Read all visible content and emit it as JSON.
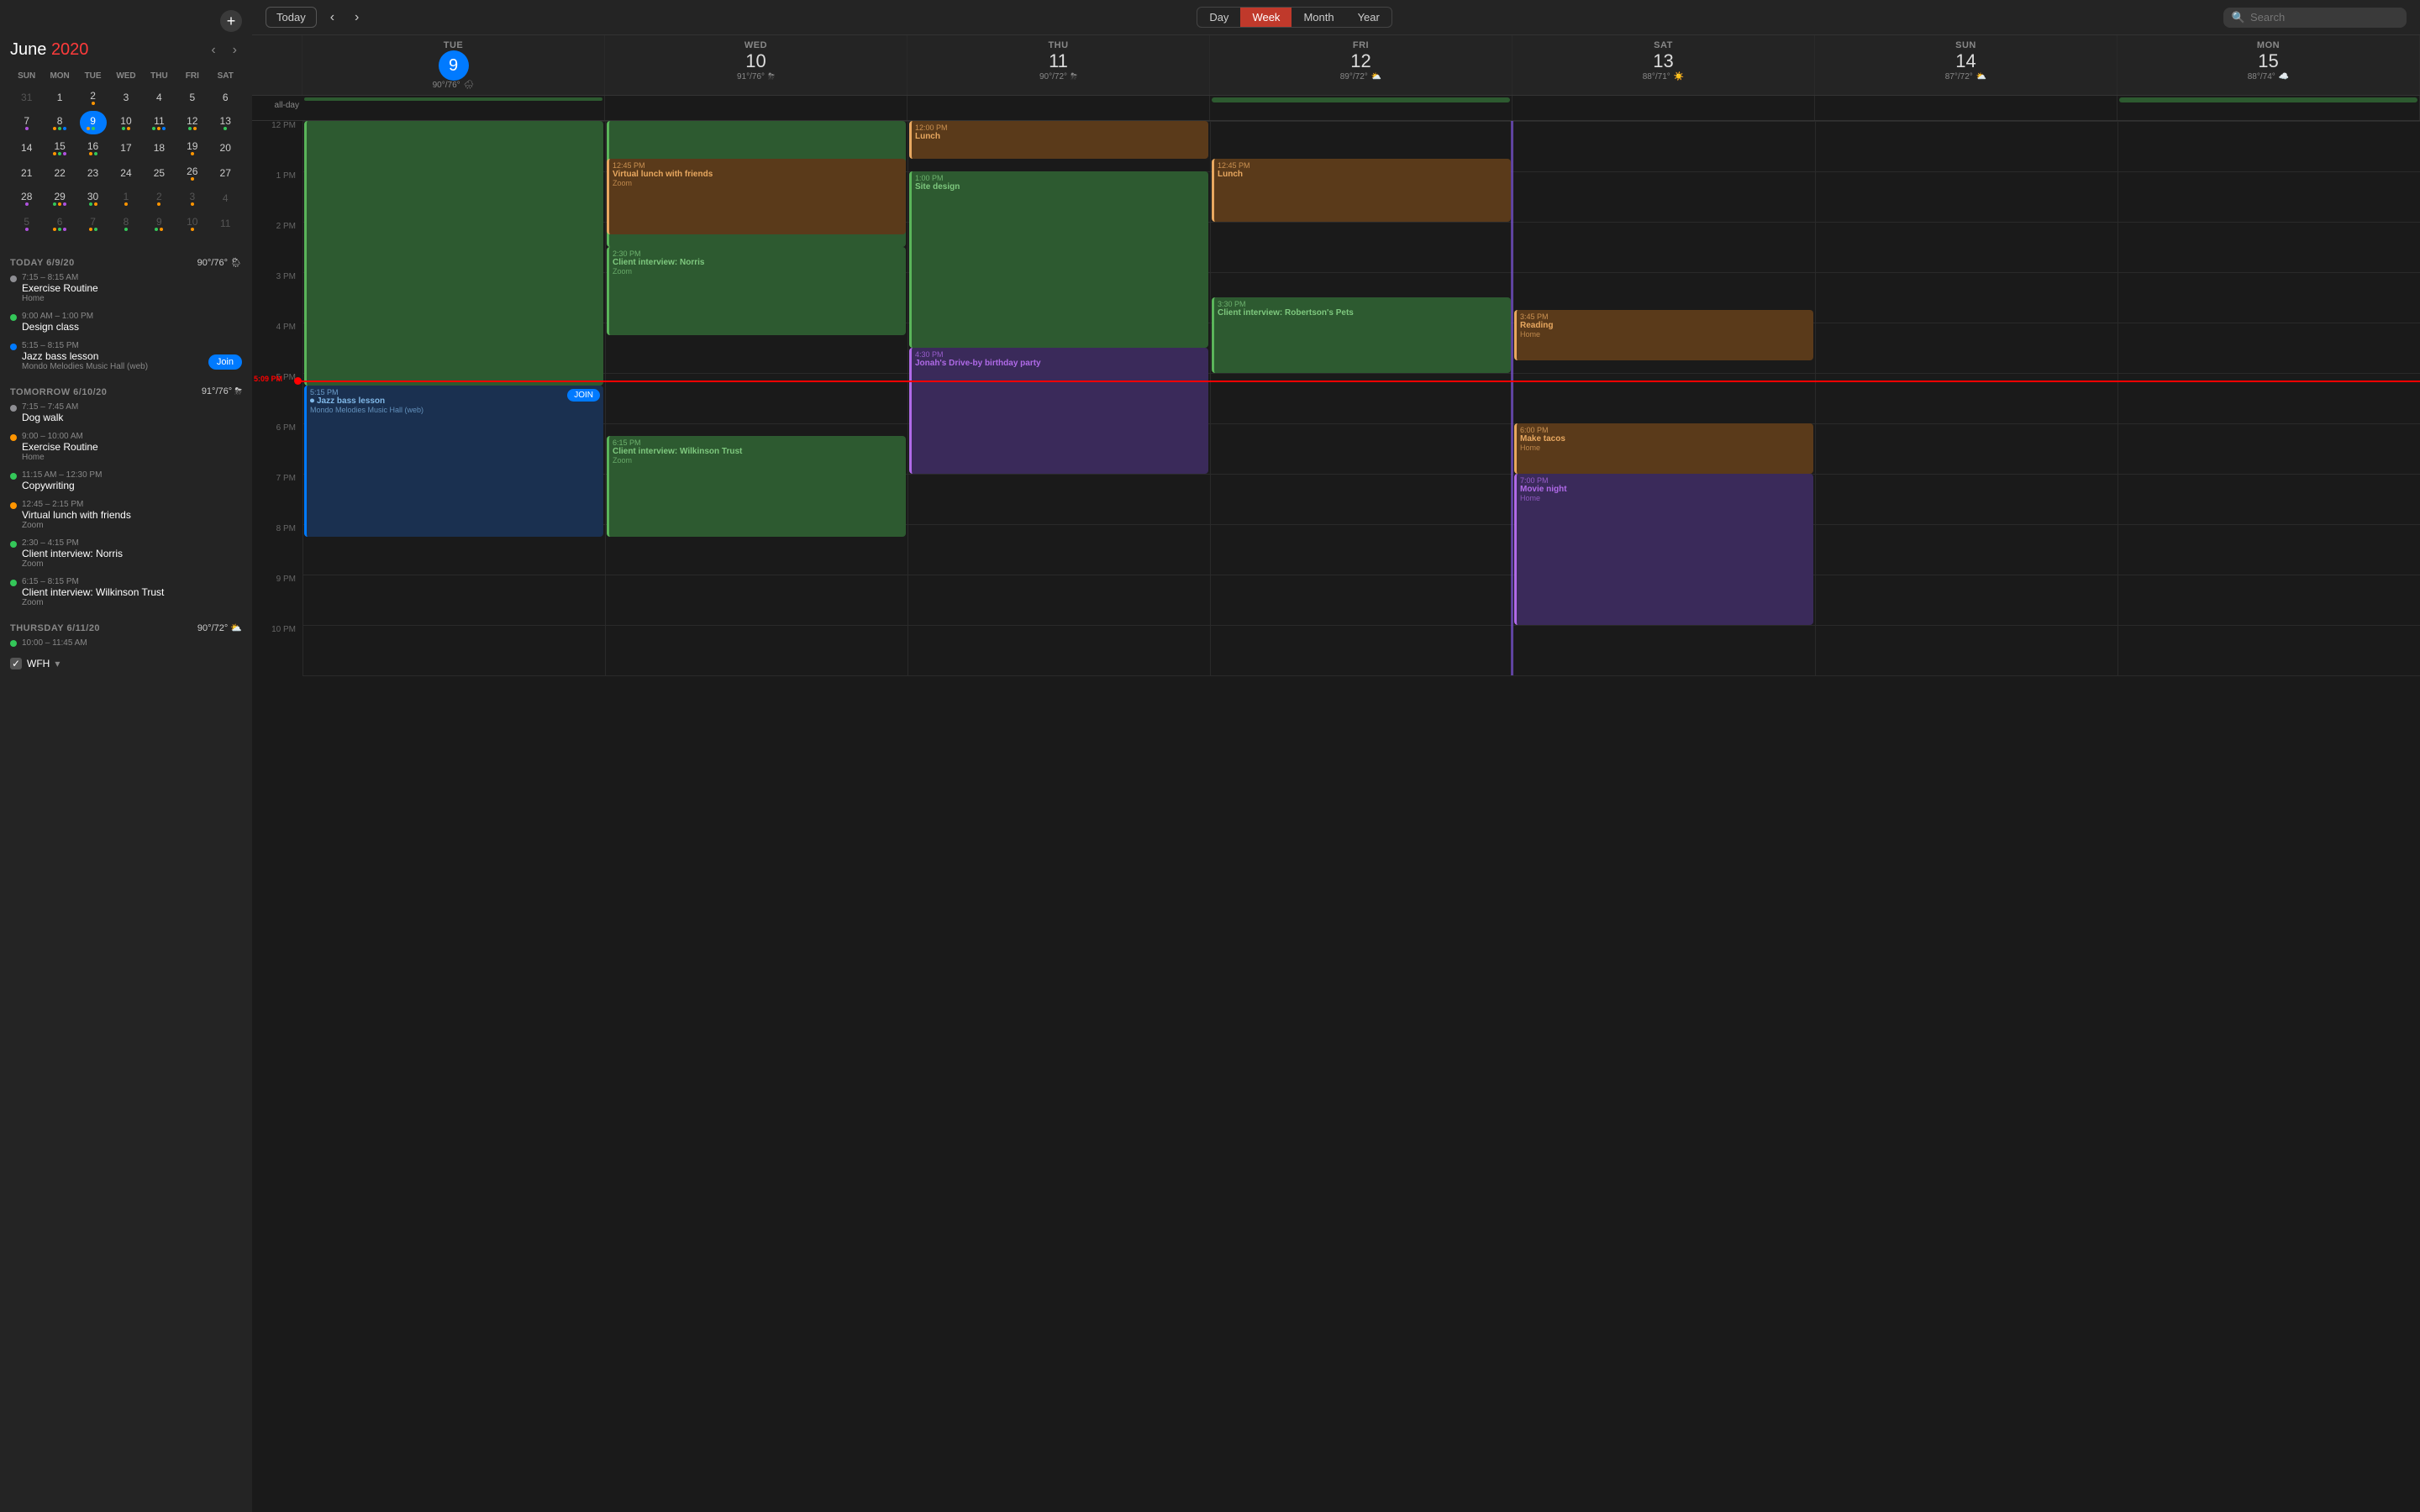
{
  "sidebar": {
    "add_btn": "+",
    "month": "June",
    "year": "2020",
    "nav_prev": "‹",
    "nav_next": "›",
    "mini_cal": {
      "headers": [
        "SUN",
        "MON",
        "TUE",
        "WED",
        "THU",
        "FRI",
        "SAT"
      ],
      "rows": [
        [
          {
            "num": "31",
            "other": true,
            "dots": []
          },
          {
            "num": "1",
            "dots": []
          },
          {
            "num": "2",
            "dots": [
              "orange"
            ]
          },
          {
            "num": "3",
            "dots": []
          },
          {
            "num": "4",
            "dots": []
          },
          {
            "num": "5",
            "dots": []
          },
          {
            "num": "6",
            "dots": []
          }
        ],
        [
          {
            "num": "7",
            "dots": [
              "purple"
            ]
          },
          {
            "num": "8",
            "dots": [
              "orange",
              "green",
              "blue"
            ]
          },
          {
            "num": "9",
            "today": true,
            "dots": [
              "orange",
              "green",
              "blue"
            ]
          },
          {
            "num": "10",
            "dots": [
              "green",
              "orange"
            ]
          },
          {
            "num": "11",
            "dots": [
              "green",
              "orange",
              "blue"
            ]
          },
          {
            "num": "12",
            "dots": [
              "green",
              "orange"
            ]
          },
          {
            "num": "13",
            "dots": [
              "green"
            ]
          }
        ],
        [
          {
            "num": "14",
            "dots": []
          },
          {
            "num": "15",
            "dots": [
              "orange",
              "green",
              "purple"
            ]
          },
          {
            "num": "16",
            "dots": [
              "orange",
              "green"
            ]
          },
          {
            "num": "17",
            "dots": []
          },
          {
            "num": "18",
            "dots": []
          },
          {
            "num": "19",
            "dots": [
              "orange"
            ]
          },
          {
            "num": "20",
            "dots": []
          }
        ],
        [
          {
            "num": "21",
            "dots": []
          },
          {
            "num": "22",
            "dots": []
          },
          {
            "num": "23",
            "dots": []
          },
          {
            "num": "24",
            "dots": []
          },
          {
            "num": "25",
            "dots": []
          },
          {
            "num": "26",
            "dots": [
              "orange"
            ]
          },
          {
            "num": "27",
            "dots": []
          }
        ],
        [
          {
            "num": "28",
            "dots": [
              "purple"
            ]
          },
          {
            "num": "29",
            "dots": [
              "green",
              "orange",
              "purple"
            ]
          },
          {
            "num": "30",
            "dots": [
              "green",
              "orange"
            ]
          },
          {
            "num": "1",
            "other": true,
            "dots": [
              "orange"
            ]
          },
          {
            "num": "2",
            "other": true,
            "dots": [
              "orange"
            ]
          },
          {
            "num": "3",
            "other": true,
            "dots": [
              "orange"
            ]
          },
          {
            "num": "4",
            "other": true,
            "dots": []
          }
        ],
        [
          {
            "num": "5",
            "other": true,
            "dots": [
              "purple"
            ]
          },
          {
            "num": "6",
            "other": true,
            "dots": [
              "orange",
              "green",
              "purple"
            ]
          },
          {
            "num": "7",
            "other": true,
            "dots": [
              "orange",
              "green"
            ]
          },
          {
            "num": "8",
            "other": true,
            "dots": [
              "green"
            ]
          },
          {
            "num": "9",
            "other": true,
            "dots": [
              "green",
              "orange"
            ]
          },
          {
            "num": "10",
            "other": true,
            "dots": [
              "orange"
            ]
          },
          {
            "num": "11",
            "other": true,
            "dots": []
          }
        ]
      ]
    },
    "today_label": "TODAY",
    "today_date": "6/9/20",
    "today_weather": "90°/76°",
    "today_icon": "🌦",
    "today_events": [
      {
        "dot_color": "#8e8e93",
        "time": "7:15 – 8:15 AM",
        "name": "Exercise Routine",
        "sub": "Home",
        "show_join": false
      },
      {
        "dot_color": "#34c759",
        "time": "9:00 AM – 1:00 PM",
        "name": "Design class",
        "sub": "",
        "show_join": false
      },
      {
        "dot_color": "#007aff",
        "time": "5:15 – 8:15 PM",
        "name": "Jazz bass lesson",
        "sub": "Mondo Melodies Music Hall (web)",
        "show_join": true
      }
    ],
    "tomorrow_label": "TOMORROW",
    "tomorrow_date": "6/10/20",
    "tomorrow_weather": "91°/76°",
    "tomorrow_icon": "⛈",
    "tomorrow_events": [
      {
        "dot_color": "#8e8e93",
        "time": "7:15 – 7:45 AM",
        "name": "Dog walk",
        "sub": ""
      },
      {
        "dot_color": "#ff9500",
        "time": "9:00 – 10:00 AM",
        "name": "Exercise Routine",
        "sub": "Home"
      },
      {
        "dot_color": "#34c759",
        "time": "11:15 AM – 12:30 PM",
        "name": "Copywriting",
        "sub": ""
      },
      {
        "dot_color": "#ff9500",
        "time": "12:45 – 2:15 PM",
        "name": "Virtual lunch with friends",
        "sub": "Zoom"
      },
      {
        "dot_color": "#34c759",
        "time": "2:30 – 4:15 PM",
        "name": "Client interview: Norris",
        "sub": "Zoom"
      },
      {
        "dot_color": "#34c759",
        "time": "6:15 – 8:15 PM",
        "name": "Client interview: Wilkinson Trust",
        "sub": "Zoom"
      }
    ],
    "thursday_label": "THURSDAY",
    "thursday_date": "6/11/20",
    "thursday_weather": "90°/72°",
    "thursday_icon": "⛅",
    "thursday_events": [
      {
        "dot_color": "#34c759",
        "time": "10:00 – 11:45 AM",
        "name": "",
        "sub": ""
      }
    ],
    "wfh_label": "WFH",
    "join_label": "Join"
  },
  "toolbar": {
    "prev_arrow": "‹",
    "next_arrow": "›",
    "today_label": "Today",
    "views": [
      "Day",
      "Week",
      "Month",
      "Year"
    ],
    "active_view": "Week",
    "search_placeholder": "Search"
  },
  "calendar": {
    "days": [
      {
        "abbr": "TUE",
        "num": "9",
        "today": true,
        "high": "90°",
        "low": "76°",
        "weather": "🌧",
        "weather_label": "rain"
      },
      {
        "abbr": "WED",
        "num": "10",
        "today": false,
        "high": "91°",
        "low": "76°",
        "weather": "⛈",
        "weather_label": "thunder"
      },
      {
        "abbr": "THU",
        "num": "11",
        "today": false,
        "high": "90°",
        "low": "72°",
        "weather": "⛈",
        "weather_label": "thunder"
      },
      {
        "abbr": "FRI",
        "num": "12",
        "today": false,
        "high": "89°",
        "low": "72°",
        "weather": "⛅",
        "weather_label": "partly-cloudy"
      },
      {
        "abbr": "SAT",
        "num": "13",
        "today": false,
        "high": "88°",
        "low": "71°",
        "weather": "☀️",
        "weather_label": "sunny"
      },
      {
        "abbr": "SUN",
        "num": "14",
        "today": false,
        "high": "87°",
        "low": "72°",
        "weather": "⛅",
        "weather_label": "partly-cloudy"
      },
      {
        "abbr": "MON",
        "num": "15",
        "today": false,
        "high": "88°",
        "low": "74°",
        "weather": "☁️",
        "weather_label": "cloudy"
      }
    ],
    "allday_events": [
      {
        "col": 1,
        "text": "",
        "color": "ev-green",
        "span": 1
      },
      {
        "col": 5,
        "text": "",
        "color": "ev-green",
        "span": 1
      },
      {
        "col": 7,
        "text": "",
        "color": "ev-green",
        "span": 1
      }
    ],
    "time_slots": [
      "12 PM",
      "1 PM",
      "2 PM",
      "3 PM",
      "4 PM",
      "5 PM",
      "6 PM",
      "7 PM",
      "8 PM",
      "9 PM",
      "10 PM"
    ],
    "current_time": "5:09 PM",
    "events": [
      {
        "col": 1,
        "top_pct": 0,
        "height_pct": 6,
        "label": "",
        "time": "",
        "name": "",
        "loc": "",
        "color": "ev-green",
        "start_hour_offset": 0,
        "start_min": 0,
        "dur_min": 300,
        "day_start_hour": 12
      },
      {
        "col": 2,
        "top_pct": 0,
        "height_pct": 4,
        "label": "",
        "time": "",
        "name": "",
        "loc": "",
        "color": "ev-green",
        "start_hour_offset": 0,
        "start_min": 0,
        "dur_min": 240,
        "day_start_hour": 12
      },
      {
        "col": 2,
        "top_pct": 18,
        "height_pct": 18,
        "label": "12:45 PM",
        "time": "12:45 PM",
        "name": "Virtual lunch with friends",
        "loc": "Zoom",
        "color": "ev-orange"
      },
      {
        "col": 3,
        "top_pct": 0,
        "height_pct": 6,
        "label": "12:00 PM",
        "time": "12:00 PM",
        "name": "Lunch",
        "loc": "",
        "color": "ev-orange"
      },
      {
        "col": 3,
        "top_pct": 8,
        "height_pct": 18,
        "label": "1:00 PM",
        "time": "1:00 PM",
        "name": "Site design",
        "loc": "",
        "color": "ev-green"
      },
      {
        "col": 3,
        "top_pct": 30,
        "height_pct": 22,
        "label": "4:30 PM",
        "time": "4:30 PM",
        "name": "Jonah's Drive-by birthday party",
        "loc": "",
        "color": "ev-purple"
      },
      {
        "col": 4,
        "top_pct": 12,
        "height_pct": 22,
        "label": "12:45 PM",
        "time": "12:45 PM",
        "name": "Lunch",
        "loc": "",
        "color": "ev-orange"
      },
      {
        "col": 4,
        "top_pct": 33,
        "height_pct": 14,
        "label": "3:30 PM",
        "time": "3:30 PM",
        "name": "Client interview: Robertson's Pets",
        "loc": "",
        "color": "ev-green"
      },
      {
        "col": 5,
        "top_pct": 24,
        "height_pct": 8,
        "label": "3:45 PM",
        "time": "3:45 PM",
        "name": "Reading",
        "loc": "Home",
        "color": "ev-orange"
      },
      {
        "col": 5,
        "top_pct": 48,
        "height_pct": 16,
        "label": "6:00 PM",
        "time": "6:00 PM",
        "name": "Make tacos",
        "loc": "Home",
        "color": "ev-orange"
      },
      {
        "col": 5,
        "top_pct": 57,
        "height_pct": 16,
        "label": "7:00 PM",
        "time": "7:00 PM",
        "name": "Movie night",
        "loc": "Home",
        "color": "ev-purple"
      }
    ],
    "jazz_event": {
      "col": 1,
      "time": "5:15 PM",
      "name": "Jazz bass lesson",
      "loc": "Mondo Melodies Music Hall (web)",
      "color": "ev-light-blue",
      "join_label": "JOIN"
    },
    "wed_client_event": {
      "col": 2,
      "time": "2:30 PM",
      "name": "Client interview: Norris",
      "loc": "Zoom",
      "color": "ev-green"
    },
    "wed_client2_event": {
      "col": 2,
      "time": "6:15 PM",
      "name": "Client interview: Wilkinson Trust",
      "loc": "Zoom",
      "color": "ev-green"
    }
  }
}
